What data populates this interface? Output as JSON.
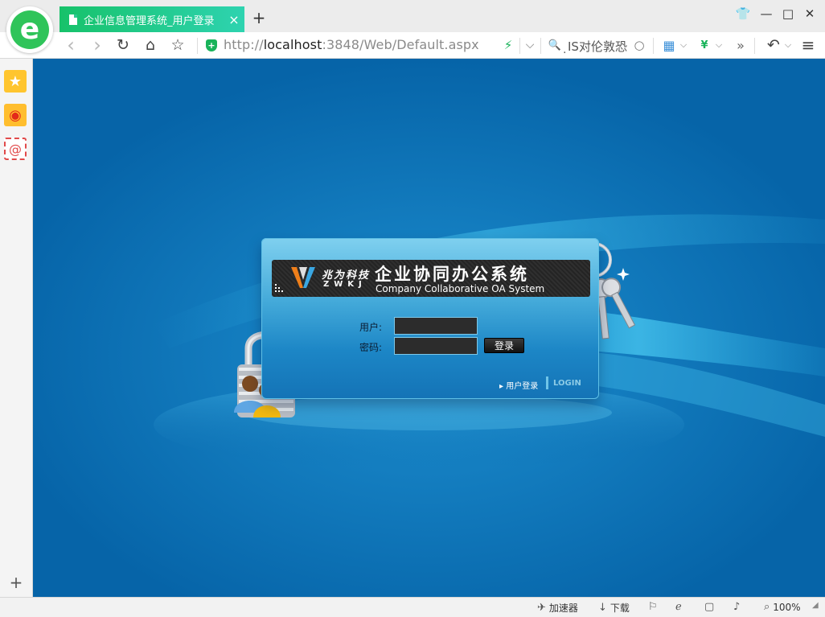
{
  "browser": {
    "tab_title": "企业信息管理系统_用户登录",
    "tab_close": "×",
    "new_tab": "+",
    "url_scheme": "http://",
    "url_host": "localhost",
    "url_rest": ":3848/Web/Default.aspx",
    "search_text": "̣IS对伦敦恐",
    "icons": {
      "logo": "e",
      "back": "‹",
      "forward": "›",
      "reload": "↻",
      "home": "⌂",
      "star": "☆",
      "bolt": "⚡",
      "dropdown": "⌵",
      "search": "🔍",
      "magnifier": "○",
      "apps": "▦",
      "yuan_shield": "¥",
      "more": "»",
      "undo": "↶",
      "menu": "≡"
    },
    "window_controls": {
      "skin": "👕",
      "minimize": "—",
      "maximize": "□",
      "close": "✕"
    }
  },
  "sidebar": {
    "favorites": "★",
    "weibo": "◉",
    "mail": "@",
    "add": "+"
  },
  "login": {
    "brand_cn": "兆为科技",
    "brand_en": "ZWKJ",
    "system_cn": "企业协同办公系统",
    "system_en": "Company Collaborative OA System",
    "username_label": "用户:",
    "username_value": "",
    "password_label": "密码:",
    "password_value": "",
    "login_button": "登录",
    "footer_user_login": "▸ 用户登录",
    "footer_login": "LOGIN"
  },
  "statusbar": {
    "accelerator": "加速器",
    "download": "下载",
    "zoom": "100%"
  },
  "colors": {
    "tab_gradient_start": "#17c26a",
    "tab_gradient_end": "#2ed3b0",
    "page_bg": "#0a72b4",
    "shield_green": "#19b35a"
  }
}
